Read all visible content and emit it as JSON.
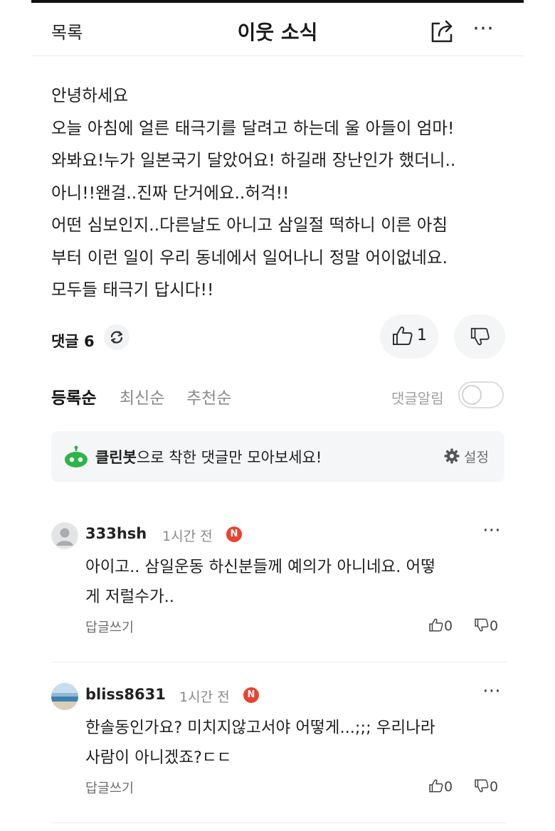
{
  "header": {
    "back_label": "목록",
    "title": "이웃 소식",
    "share_icon": "share-icon",
    "more_icon": "more-icon"
  },
  "post": {
    "lines": [
      "안녕하세요",
      "오늘 아침에 얼른 태극기를 달려고 하는데 울 아들이 엄마!",
      "와봐요!누가 일본국기 달았어요! 하길래 장난인가 했더니..",
      "아니!!왠걸..진짜 단거에요..허걱!!",
      "어떤 심보인지..다른날도 아니고 삼일절 떡하니 이른 아침",
      "부터 이런 일이 우리 동네에서 일어나니 정말 어이없네요.",
      "모두들 태극기 답시다!!"
    ]
  },
  "stats": {
    "comment_label": "댓글",
    "comment_count": "6",
    "like_count": "1"
  },
  "sort": {
    "options": [
      "등록순",
      "최신순",
      "추천순"
    ],
    "active": "등록순",
    "notify_label": "댓글알림",
    "notify_on": false
  },
  "cleanbot": {
    "name": "클린봇",
    "message": "으로 착한 댓글만 모아보세요!",
    "settings_label": "설정"
  },
  "comments": [
    {
      "username": "333hsh",
      "time": "1시간 전",
      "badge": "N",
      "lines": [
        "아이고.. 삼일운동 하신분들께 예의가 아니네요. 어떻",
        "게 저럴수가.."
      ],
      "reply_label": "답글쓰기",
      "likes": "0",
      "dislikes": "0"
    },
    {
      "username": "bliss8631",
      "time": "1시간 전",
      "badge": "N",
      "lines": [
        "한솔동인가요? 미치지않고서야 어떻게...;;; 우리나라",
        "사람이 아니겠죠?ㄷㄷ"
      ],
      "reply_label": "답글쓰기",
      "likes": "0",
      "dislikes": "0"
    }
  ],
  "colors": {
    "badge": "#e8432f",
    "cleanbot_bg": "#f5f6f7",
    "bot_green": "#2fb34a"
  }
}
